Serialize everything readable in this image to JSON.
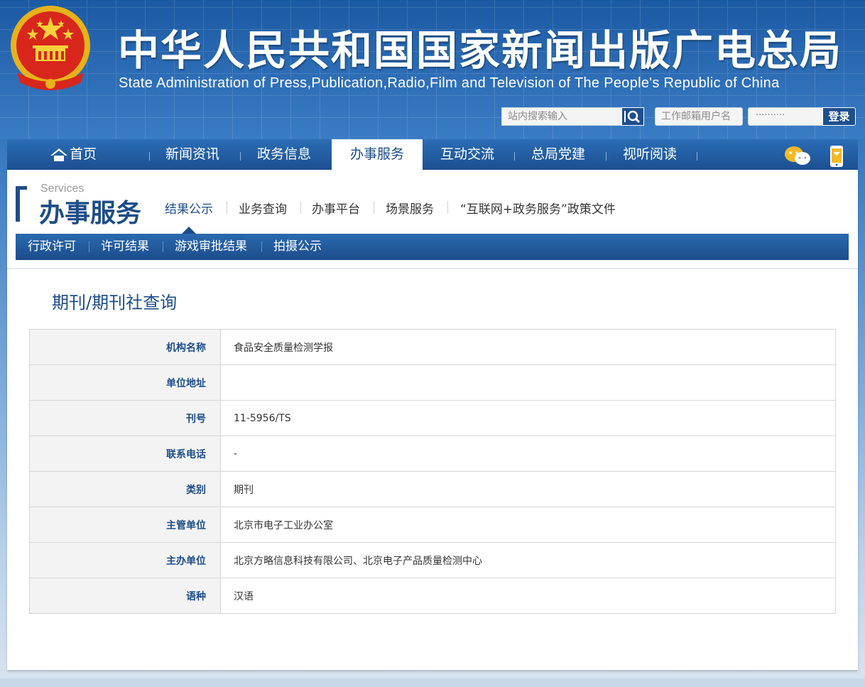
{
  "header": {
    "title": "中华人民共和国国家新闻出版广电总局",
    "subtitle": "State Administration of Press,Publication,Radio,Film and Television of The People's Republic of China",
    "search_placeholder": "站内搜索输入",
    "mail_user_placeholder": "工作邮箱用户名",
    "mail_password_mask": "··········",
    "login_label": "登录"
  },
  "nav": {
    "items": [
      {
        "label": "首页",
        "icon": "home-icon"
      },
      {
        "label": "新闻资讯"
      },
      {
        "label": "政务信息"
      },
      {
        "label": "办事服务",
        "active": true
      },
      {
        "label": "互动交流"
      },
      {
        "label": "总局党建"
      },
      {
        "label": "视听阅读"
      }
    ],
    "right_icons": [
      "wechat-icon",
      "mobile-phone-icon"
    ]
  },
  "section": {
    "en": "Services",
    "cn": "办事服务",
    "subnav": [
      "结果公示",
      "业务查询",
      "办事平台",
      "场景服务",
      "“互联网+政务服务”政策文件"
    ],
    "active_subnav": "结果公示"
  },
  "tabs": [
    "行政许可",
    "许可结果",
    "游戏审批结果",
    "拍摄公示"
  ],
  "page": {
    "title": "期刊/期刊社查询"
  },
  "table": [
    {
      "label": "机构名称",
      "value": "食品安全质量检测学报"
    },
    {
      "label": "单位地址",
      "value": ""
    },
    {
      "label": "刊号",
      "value": "11-5956/TS"
    },
    {
      "label": "联系电话",
      "value": "-"
    },
    {
      "label": "类别",
      "value": "期刊"
    },
    {
      "label": "主管单位",
      "value": "北京市电子工业办公室"
    },
    {
      "label": "主办单位",
      "value": "北京方略信息科技有限公司、北京电子产品质量检测中心"
    },
    {
      "label": "语种",
      "value": "汉语"
    }
  ],
  "colors": {
    "brand_blue": "#1d4d89",
    "nav_blue": "#2b6db5",
    "emblem_red": "#d8261c",
    "emblem_gold": "#f2c21b"
  }
}
